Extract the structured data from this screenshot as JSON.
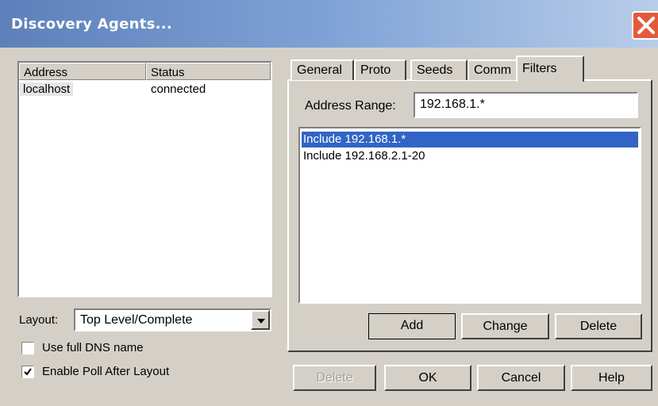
{
  "window": {
    "title": "Discovery Agents..."
  },
  "agents": {
    "columns": [
      "Address",
      "Status"
    ],
    "rows": [
      {
        "address": "localhost",
        "status": "connected"
      }
    ]
  },
  "layout": {
    "label": "Layout:",
    "value": "Top Level/Complete"
  },
  "checkboxes": {
    "dns": {
      "label": "Use full DNS name",
      "checked": false
    },
    "poll": {
      "label": "Enable Poll After Layout",
      "checked": true
    }
  },
  "tabs": [
    "General",
    "Proto",
    "Seeds",
    "Comm",
    "Filters"
  ],
  "active_tab": "Filters",
  "filters": {
    "range_label": "Address Range:",
    "range_value": "192.168.1.*",
    "items": [
      "Include 192.168.1.*",
      "Include 192.168.2.1-20"
    ],
    "selected_index": 0,
    "buttons": {
      "add": "Add",
      "change": "Change",
      "delete": "Delete"
    }
  },
  "footer": {
    "delete": "Delete",
    "ok": "OK",
    "cancel": "Cancel",
    "help": "Help"
  },
  "colors": {
    "selection": "#3164c5",
    "titlebar_start": "#5d80ba",
    "face": "#d4d0c8"
  }
}
